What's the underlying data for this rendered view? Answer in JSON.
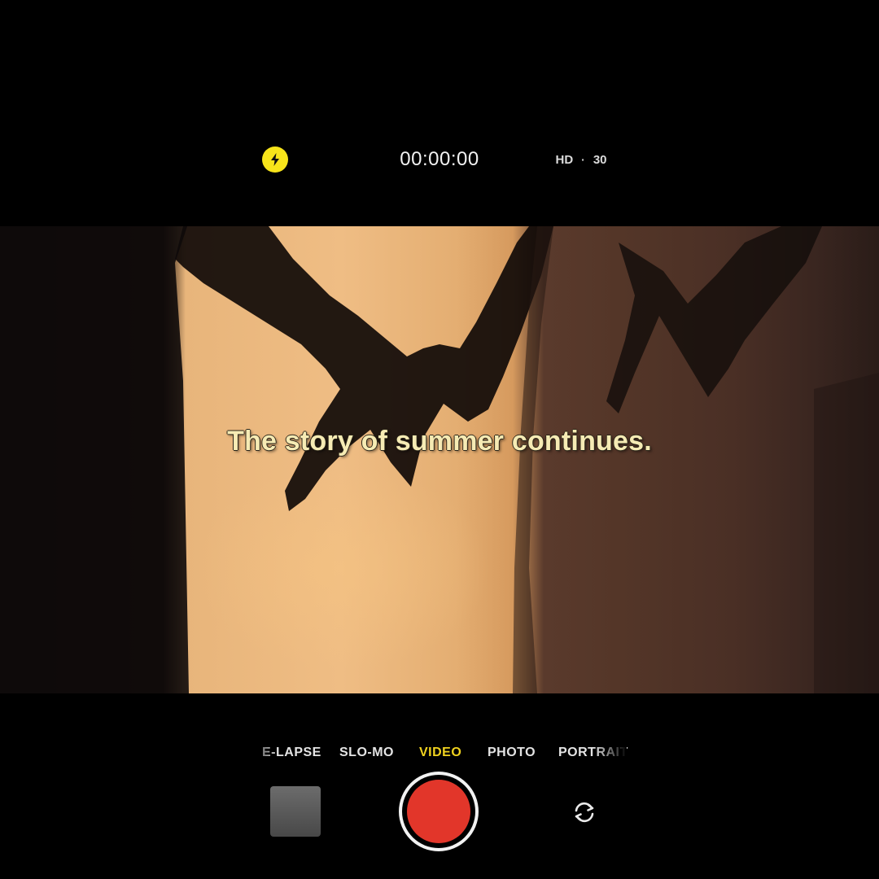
{
  "status_bar": {
    "flash_icon": "lightning-bolt-icon",
    "timer": "00:00:00",
    "resolution": "HD",
    "separator": "·",
    "frame_rate": "30"
  },
  "viewfinder": {
    "caption": "The story of summer continues."
  },
  "modes": {
    "items": [
      {
        "label": "E-LAPSE"
      },
      {
        "label": "SLO-MO"
      },
      {
        "label": "VIDEO"
      },
      {
        "label": "PHOTO"
      },
      {
        "label": "PORTRAIT"
      }
    ],
    "active": "VIDEO"
  },
  "controls": {
    "thumbnail_icon": "gallery-thumbnail",
    "shutter_icon": "record-button",
    "flip_icon": "camera-flip-icon"
  },
  "colors": {
    "accent": "#f1d31f",
    "flash": "#f7e41a",
    "record": "#e2362a"
  }
}
